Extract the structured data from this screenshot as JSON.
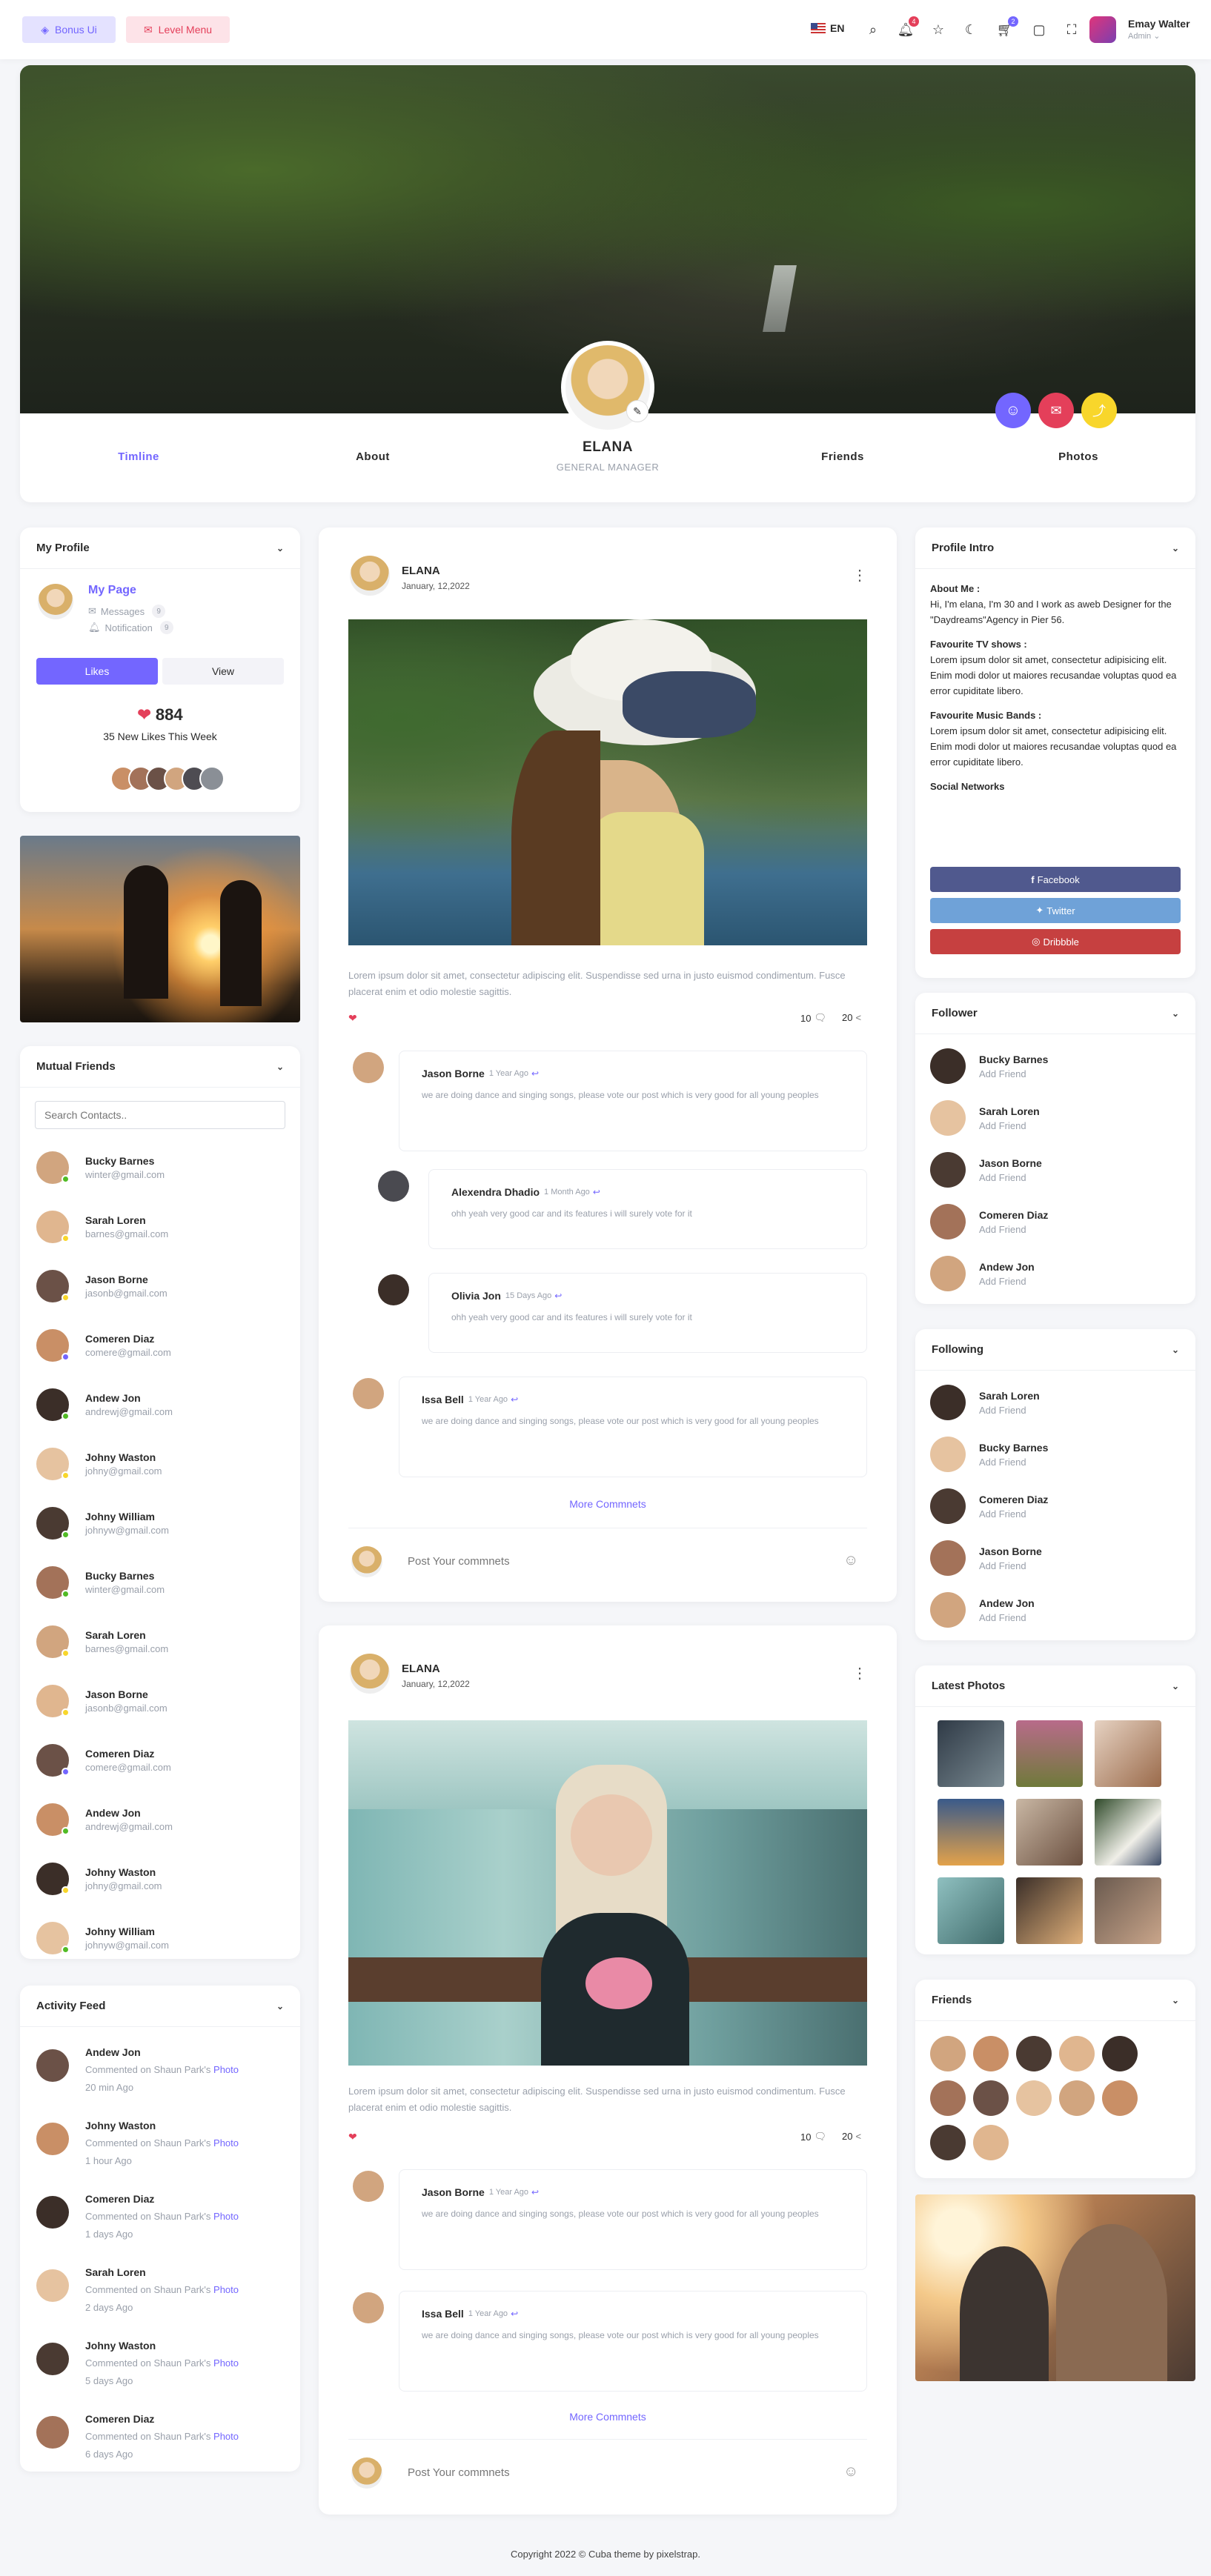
{
  "header": {
    "bonus_ui": "Bonus Ui",
    "level_menu": "Level Menu",
    "lang": "EN",
    "notif_count": "4",
    "cart_count": "2",
    "user_name": "Emay Walter",
    "user_role": "Admin"
  },
  "profile": {
    "name": "ELANA",
    "title": "GENERAL MANAGER",
    "tabs": [
      "Timline",
      "About",
      "Friends",
      "Photos"
    ]
  },
  "my_profile": {
    "heading": "My Profile",
    "page_link": "My Page",
    "messages_label": "Messages",
    "messages_count": "9",
    "notification_label": "Notification",
    "notification_count": "9",
    "likes_button": "Likes",
    "view_button": "View",
    "likes_count": "884",
    "likes_caption": "35 New Likes This Week"
  },
  "mutual_friends": {
    "heading": "Mutual Friends",
    "search_placeholder": "Search Contacts..",
    "items": [
      {
        "name": "Bucky Barnes",
        "email": "winter@gmail.com",
        "status": "#51bb25"
      },
      {
        "name": "Sarah Loren",
        "email": "barnes@gmail.com",
        "status": "#f8d62b"
      },
      {
        "name": "Jason Borne",
        "email": "jasonb@gmail.com",
        "status": "#f8d62b"
      },
      {
        "name": "Comeren Diaz",
        "email": "comere@gmail.com",
        "status": "#7366ff"
      },
      {
        "name": "Andew Jon",
        "email": "andrewj@gmail.com",
        "status": "#51bb25"
      },
      {
        "name": "Johny Waston",
        "email": "johny@gmail.com",
        "status": "#f8d62b"
      },
      {
        "name": "Johny William",
        "email": "johnyw@gmail.com",
        "status": "#51bb25"
      },
      {
        "name": "Bucky Barnes",
        "email": "winter@gmail.com",
        "status": "#51bb25"
      },
      {
        "name": "Sarah Loren",
        "email": "barnes@gmail.com",
        "status": "#f8d62b"
      },
      {
        "name": "Jason Borne",
        "email": "jasonb@gmail.com",
        "status": "#f8d62b"
      },
      {
        "name": "Comeren Diaz",
        "email": "comere@gmail.com",
        "status": "#7366ff"
      },
      {
        "name": "Andew Jon",
        "email": "andrewj@gmail.com",
        "status": "#51bb25"
      },
      {
        "name": "Johny Waston",
        "email": "johny@gmail.com",
        "status": "#f8d62b"
      },
      {
        "name": "Johny William",
        "email": "johnyw@gmail.com",
        "status": "#51bb25"
      }
    ]
  },
  "activity": {
    "heading": "Activity Feed",
    "commented": "Commented on Shaun Park's",
    "photo_word": "Photo",
    "items": [
      {
        "name": "Andew Jon",
        "time": "20 min Ago"
      },
      {
        "name": "Johny Waston",
        "time": "1 hour Ago"
      },
      {
        "name": "Comeren Diaz",
        "time": "1 days Ago"
      },
      {
        "name": "Sarah Loren",
        "time": "2 days Ago"
      },
      {
        "name": "Johny Waston",
        "time": "5 days Ago"
      },
      {
        "name": "Comeren Diaz",
        "time": "6 days Ago"
      }
    ]
  },
  "posts": [
    {
      "author": "ELANA",
      "date": "January, 12,2022",
      "text": "Lorem ipsum dolor sit amet, consectetur adipiscing elit. Suspendisse sed urna in justo euismod condimentum. Fusce placerat enim et odio molestie sagittis.",
      "comments_count": "10",
      "shares_count": "20",
      "more": "More Commnets",
      "input_placeholder": "Post Your commnets"
    },
    {
      "author": "ELANA",
      "date": "January, 12,2022",
      "text": "Lorem ipsum dolor sit amet, consectetur adipiscing elit. Suspendisse sed urna in justo euismod condimentum. Fusce placerat enim et odio molestie sagittis.",
      "comments_count": "10",
      "shares_count": "20",
      "more": "More Commnets",
      "input_placeholder": "Post Your commnets"
    }
  ],
  "comments1": [
    {
      "name": "Jason Borne",
      "ago": "1 Year Ago",
      "text": "we are doing dance and singing songs, please vote our post which is very good for all young peoples"
    },
    {
      "name": "Alexendra Dhadio",
      "ago": "1 Month Ago",
      "text": "ohh yeah very good car and its features i will surely vote for it"
    },
    {
      "name": "Olivia Jon",
      "ago": "15 Days Ago",
      "text": "ohh yeah very good car and its features i will surely vote for it"
    },
    {
      "name": "Issa Bell",
      "ago": "1 Year Ago",
      "text": "we are doing dance and singing songs, please vote our post which is very good for all young peoples"
    }
  ],
  "comments2": [
    {
      "name": "Jason Borne",
      "ago": "1 Year Ago",
      "text": "we are doing dance and singing songs, please vote our post which is very good for all young peoples"
    },
    {
      "name": "Issa Bell",
      "ago": "1 Year Ago",
      "text": "we are doing dance and singing songs, please vote our post which is very good for all young peoples"
    }
  ],
  "intro": {
    "heading": "Profile Intro",
    "about_label": "About Me :",
    "about_text": "Hi, I'm elana, I'm 30 and I work as aweb Designer for the \"Daydreams\"Agency in Pier 56.",
    "tv_label": "Favourite TV shows :",
    "tv_text": "Lorem ipsum dolor sit amet, consectetur adipisicing elit. Enim modi dolor ut maiores recusandae voluptas quod ea error cupiditate libero.",
    "music_label": "Favourite Music Bands :",
    "music_text": "Lorem ipsum dolor sit amet, consectetur adipisicing elit. Enim modi dolor ut maiores recusandae voluptas quod ea error cupiditate libero.",
    "social_label": "Social Networks",
    "facebook": "Facebook",
    "twitter": "Twitter",
    "dribbble": "Dribbble"
  },
  "follower": {
    "heading": "Follower",
    "add": "Add Friend",
    "items": [
      "Bucky Barnes",
      "Sarah Loren",
      "Jason Borne",
      "Comeren Diaz",
      "Andew Jon"
    ]
  },
  "following": {
    "heading": "Following",
    "add": "Add Friend",
    "items": [
      "Sarah Loren",
      "Bucky Barnes",
      "Comeren Diaz",
      "Jason Borne",
      "Andew Jon"
    ]
  },
  "latest_photos": {
    "heading": "Latest Photos"
  },
  "friends": {
    "heading": "Friends"
  },
  "footer": "Copyright 2022 © Cuba theme by pixelstrap.",
  "colors": {
    "primary": "#7366ff",
    "facebook": "#50598e",
    "twitter": "#6fa2d8",
    "dribbble": "#c64040"
  }
}
